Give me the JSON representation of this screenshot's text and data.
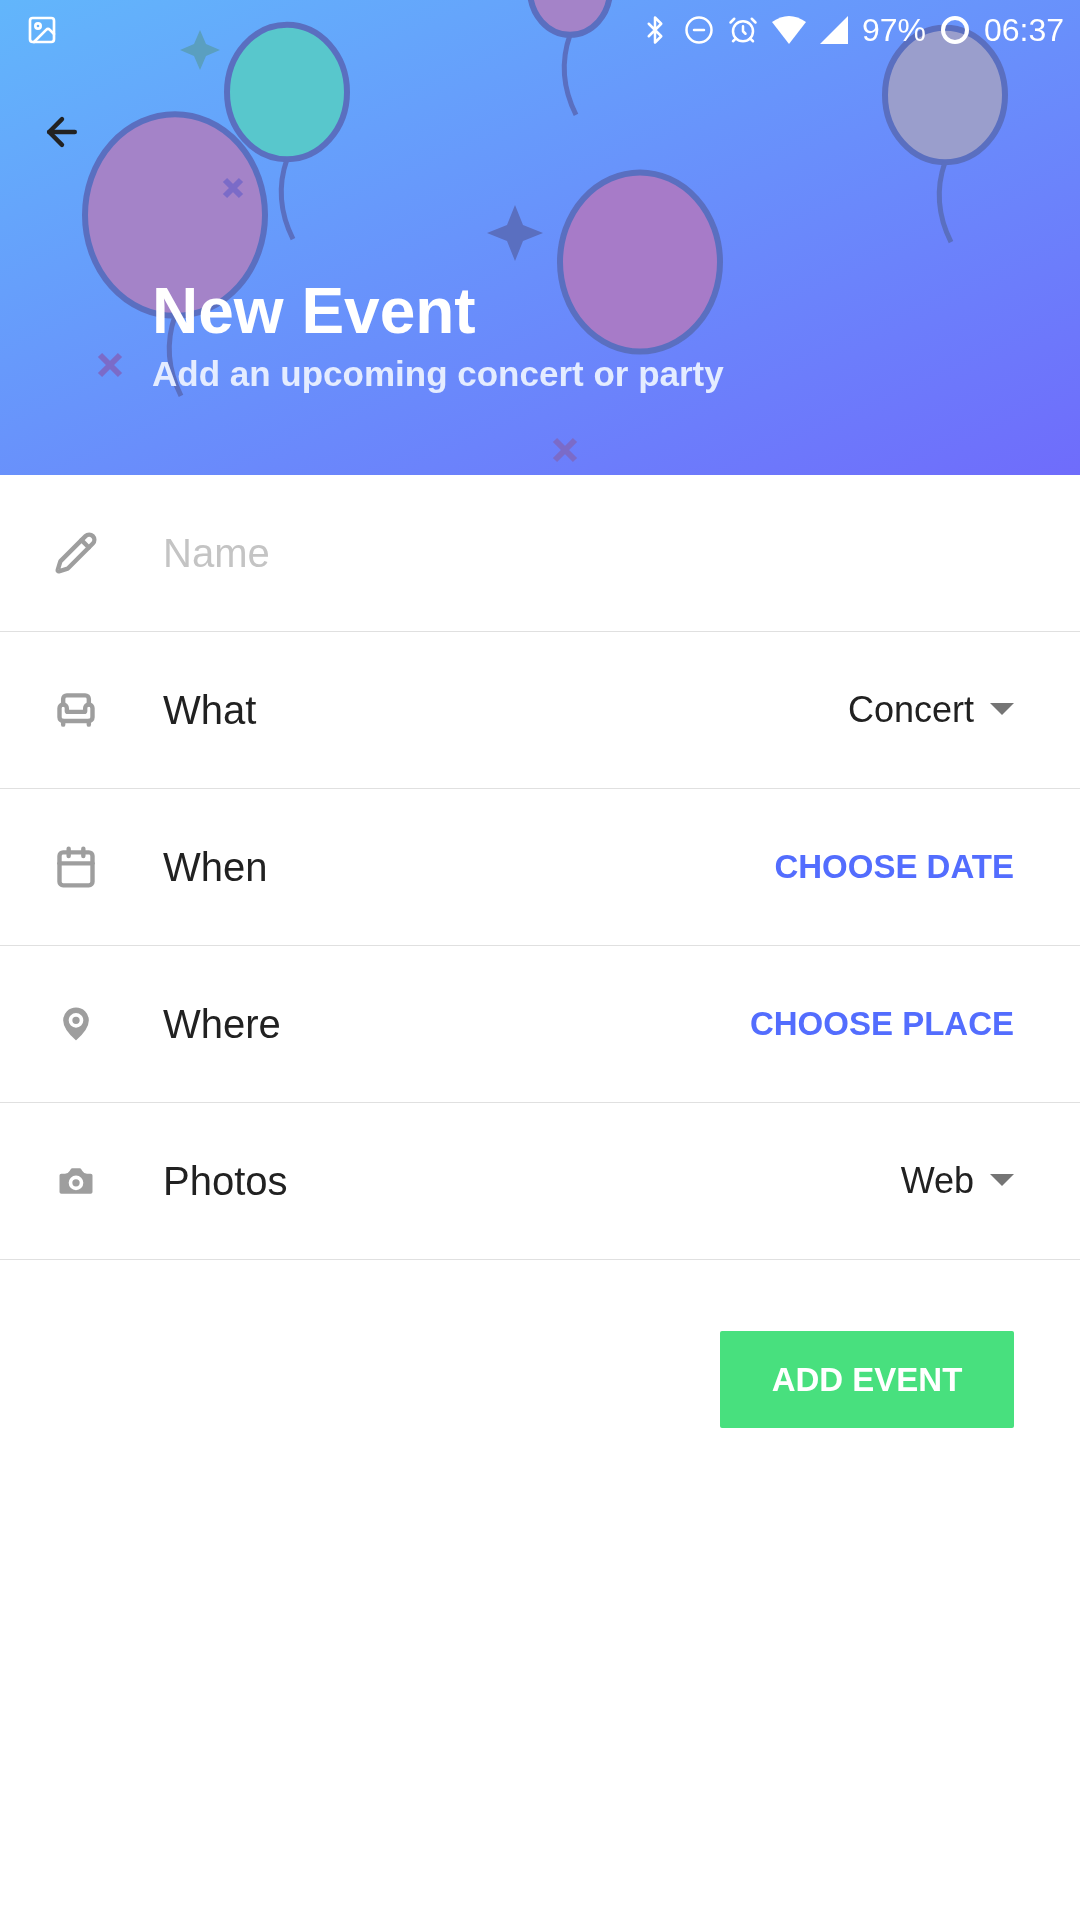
{
  "status_bar": {
    "battery": "97%",
    "time": "06:37"
  },
  "header": {
    "title": "New Event",
    "subtitle": "Add an upcoming concert or party"
  },
  "fields": [
    {
      "kind": "input",
      "placeholder": "Name"
    },
    {
      "kind": "dropdown",
      "label": "What",
      "value": "Concert"
    },
    {
      "kind": "action",
      "label": "When",
      "action": "CHOOSE DATE"
    },
    {
      "kind": "action",
      "label": "Where",
      "action": "CHOOSE PLACE"
    },
    {
      "kind": "dropdown",
      "label": "Photos",
      "value": "Web"
    }
  ],
  "submit": "ADD EVENT"
}
